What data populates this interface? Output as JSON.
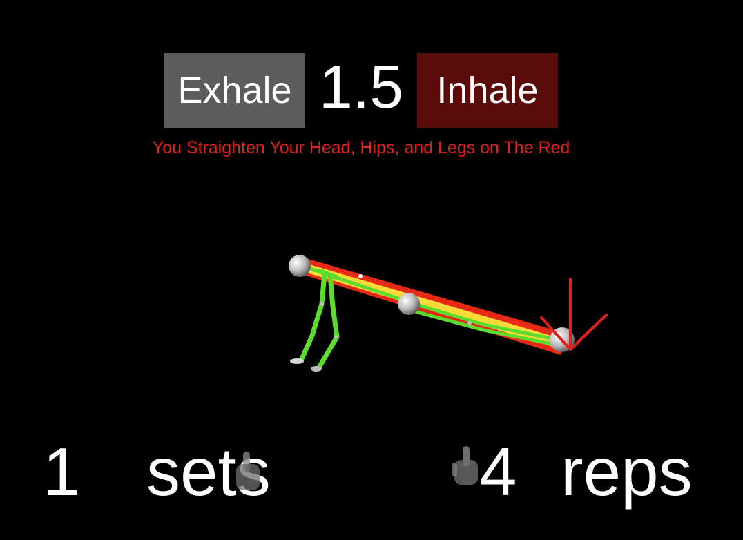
{
  "breath": {
    "exhale_label": "Exhale",
    "inhale_label": "Inhale",
    "timer": "1.5"
  },
  "instruction": "You Straighten Your Head, Hips, and Legs on The Red",
  "counters": {
    "sets_count": "1",
    "sets_label": "sets",
    "reps_count": "4",
    "reps_label": "reps"
  },
  "colors": {
    "background": "#000000",
    "exhale_bg": "#5c5c5c",
    "inhale_bg": "#5a0c0b",
    "instruction_text": "#e0201b",
    "guide_line": "#e62a16",
    "body_line": "#ffe93b",
    "skeleton": "#5cdc2c",
    "arrow": "#e0201b"
  },
  "icons": {
    "direction": "down-arrow-icon",
    "pointer": "hand-pointer-icon"
  }
}
